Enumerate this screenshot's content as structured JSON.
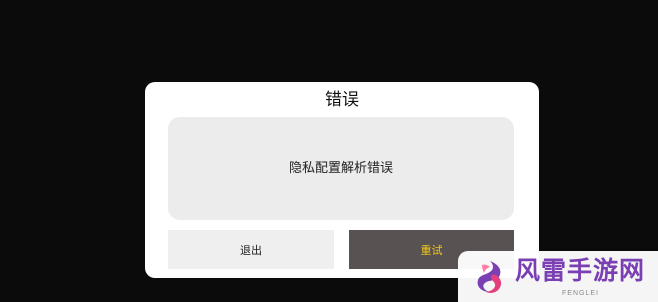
{
  "dialog": {
    "title": "错误",
    "message": "隐私配置解析错误",
    "exit_label": "退出",
    "retry_label": "重试"
  },
  "watermark": {
    "logo_text": "风雷手游网",
    "sub_text": "FENGLEI"
  },
  "colors": {
    "background": "#0b0b0c",
    "dialog": "#ffffff",
    "message_box": "#ececec",
    "exit_button": "#efefef",
    "retry_button": "#585352",
    "retry_text": "#f3c719",
    "watermark_text": "#7b3fb4"
  }
}
